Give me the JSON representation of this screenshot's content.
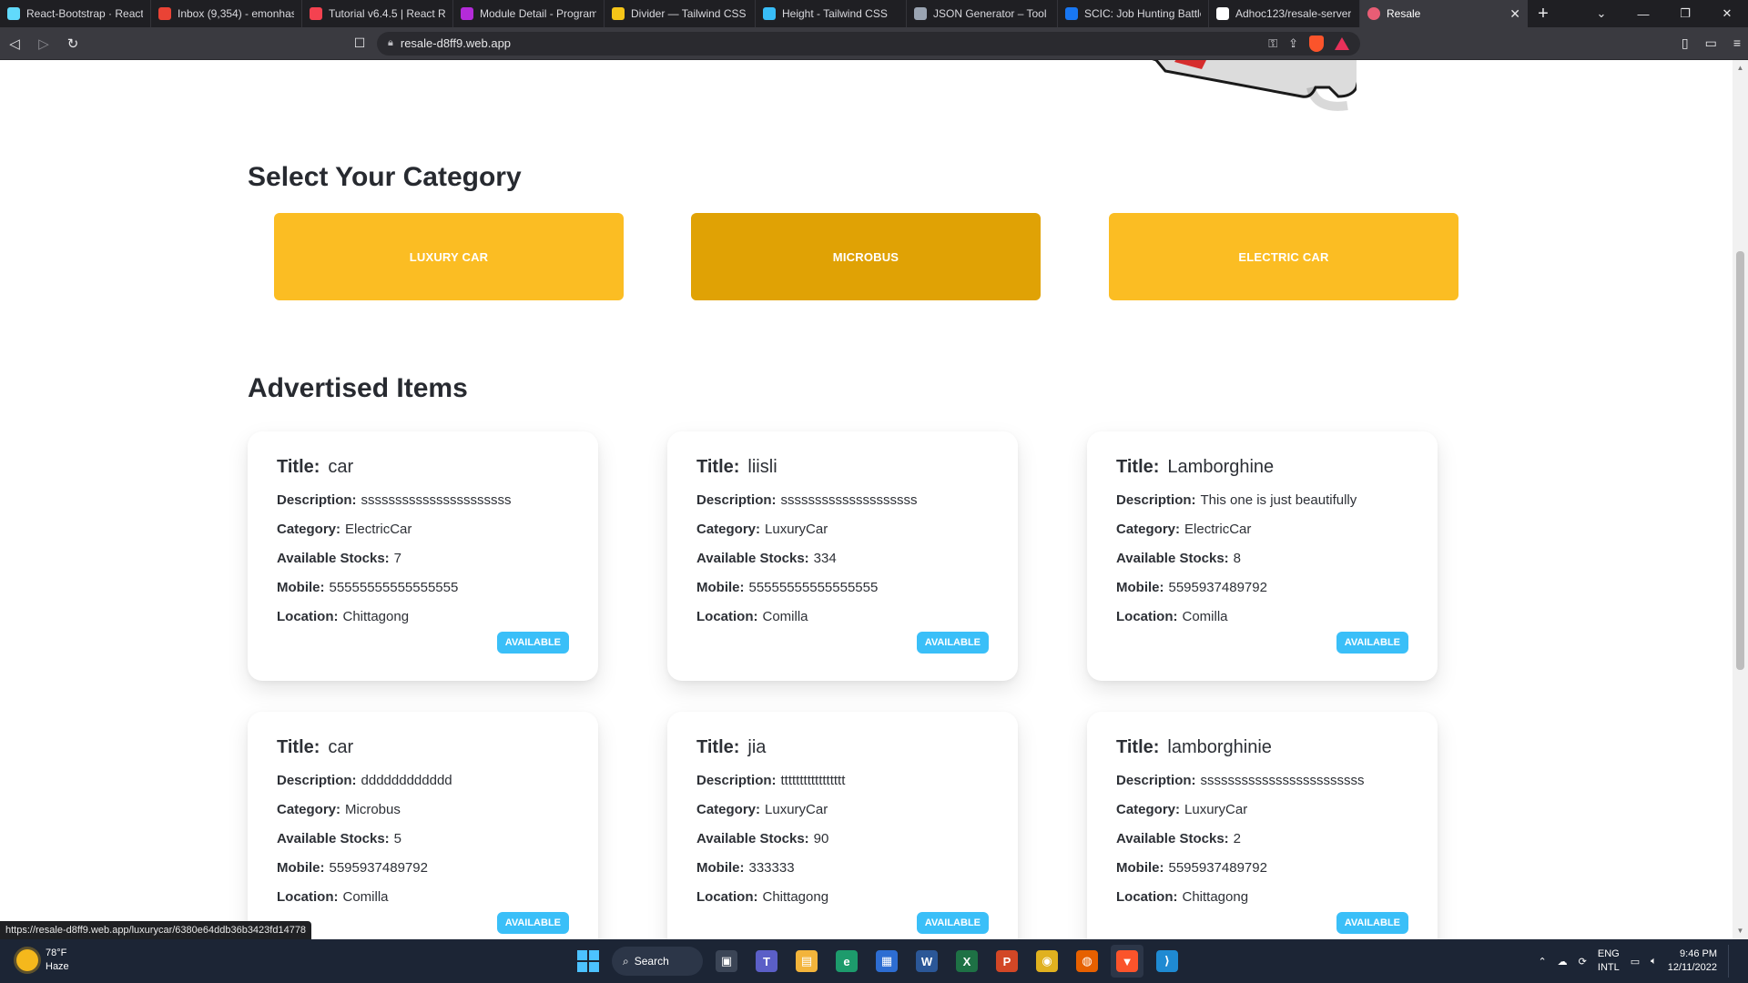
{
  "browser": {
    "tabs": [
      {
        "label": "React-Bootstrap · React",
        "icon": "react-icon",
        "color": "#61dafb"
      },
      {
        "label": "Inbox (9,354) - emonhas",
        "icon": "gmail-icon",
        "color": "#ea4335"
      },
      {
        "label": "Tutorial v6.4.5 | React R",
        "icon": "react-router-icon",
        "color": "#f44250"
      },
      {
        "label": "Module Detail - Program",
        "icon": "programming-hero-icon",
        "color": "#b42bd9"
      },
      {
        "label": "Divider — Tailwind CSS",
        "icon": "daisyui-icon",
        "color": "#f5c518"
      },
      {
        "label": "Height - Tailwind CSS",
        "icon": "tailwind-icon",
        "color": "#38bdf8"
      },
      {
        "label": "JSON Generator – Tool f",
        "icon": "json-generator-icon",
        "color": "#9aa4b2"
      },
      {
        "label": "SCIC: Job Hunting Battle",
        "icon": "facebook-icon",
        "color": "#1877f2"
      },
      {
        "label": "Adhoc123/resale-server",
        "icon": "github-icon",
        "color": "#ffffff"
      }
    ],
    "active_tab": {
      "label": "Resale",
      "icon": "resale-icon",
      "color": "#e85d75"
    },
    "new_tab": "+",
    "url": "resale-d8ff9.web.app",
    "status_url": "https://resale-d8ff9.web.app/luxurycar/6380e64ddb36b3423fd14778"
  },
  "page": {
    "category_heading": "Select Your Category",
    "categories": [
      {
        "label": "LUXURY CAR"
      },
      {
        "label": "MICROBUS"
      },
      {
        "label": "ELECTRIC CAR"
      }
    ],
    "advertised_heading": "Advertised Items",
    "field_labels": {
      "title": "Title:",
      "description": "Description:",
      "category": "Category:",
      "stocks": "Available Stocks:",
      "mobile": "Mobile:",
      "location": "Location:"
    },
    "items": [
      {
        "title": "car",
        "description": "ssssssssssssssssssssss",
        "category": "ElectricCar",
        "stocks": "7",
        "mobile": "55555555555555555",
        "location": "Chittagong",
        "badge": "AVAILABLE"
      },
      {
        "title": "liisli",
        "description": "ssssssssssssssssssss",
        "category": "LuxuryCar",
        "stocks": "334",
        "mobile": "55555555555555555",
        "location": "Comilla",
        "badge": "AVAILABLE"
      },
      {
        "title": "Lamborghine",
        "description": "This one is just beautifully",
        "category": "ElectricCar",
        "stocks": "8",
        "mobile": "5595937489792",
        "location": "Comilla",
        "badge": "AVAILABLE"
      },
      {
        "title": "car",
        "description": "dddddddddddd",
        "category": "Microbus",
        "stocks": "5",
        "mobile": "5595937489792",
        "location": "Comilla",
        "badge": "AVAILABLE"
      },
      {
        "title": "jia",
        "description": "ttttttttttttttttt",
        "category": "LuxuryCar",
        "stocks": "90",
        "mobile": "333333",
        "location": "Chittagong",
        "badge": "AVAILABLE"
      },
      {
        "title": "lamborghinie",
        "description": "ssssssssssssssssssssssss",
        "category": "LuxuryCar",
        "stocks": "2",
        "mobile": "5595937489792",
        "location": "Chittagong",
        "badge": "AVAILABLE"
      }
    ],
    "colors": {
      "category_button": "#fbbd23",
      "category_button_active": "#e0a205",
      "badge": "#3abff8"
    }
  },
  "taskbar": {
    "weather_temp": "78°F",
    "weather_desc": "Haze",
    "search_label": "Search",
    "apps": [
      "task-view-icon",
      "teams-icon",
      "file-explorer-icon",
      "edge-icon",
      "store-icon",
      "word-icon",
      "excel-icon",
      "powerpoint-icon",
      "chrome-icon",
      "firefox-icon",
      "brave-icon",
      "vscode-icon"
    ],
    "lang_top": "ENG",
    "lang_bottom": "INTL",
    "time": "9:46 PM",
    "date": "12/11/2022"
  }
}
